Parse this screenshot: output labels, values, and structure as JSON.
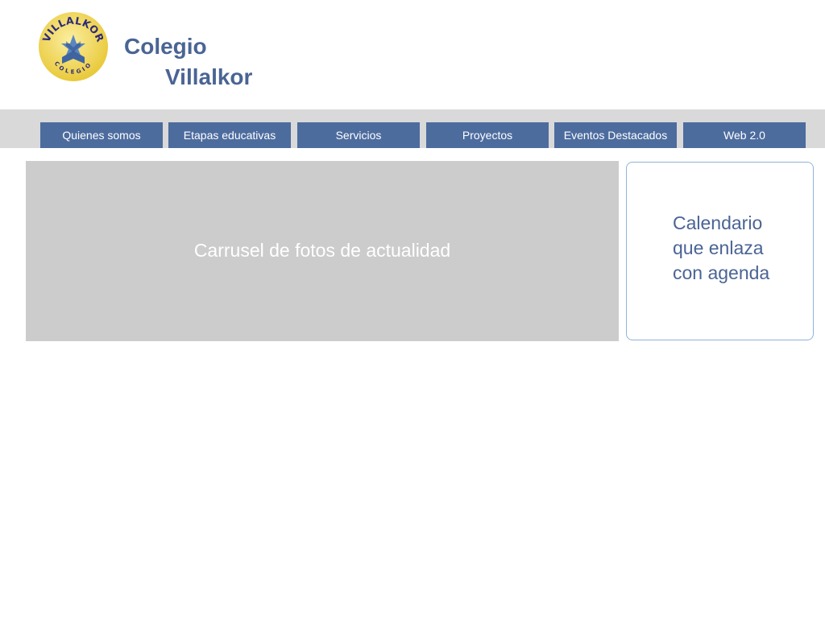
{
  "header": {
    "logo": {
      "top_text": "VILLALKOR",
      "bottom_text": "COLEGIO",
      "icon": "school-emblem-icon",
      "colors": {
        "circle": "#f2d94e",
        "text": "#2b2b7a",
        "emblem": "#4d74ad"
      }
    },
    "title_line1": "Colegio",
    "title_line2": "Villalkor",
    "title_color": "#4a6494"
  },
  "nav": {
    "band_color": "#d9d9d9",
    "button_color": "#4d6c9e",
    "items": [
      {
        "label": "Quienes somos"
      },
      {
        "label": "Etapas educativas"
      },
      {
        "label": "Servicios"
      },
      {
        "label": "Proyectos"
      },
      {
        "label": "Eventos Destacados"
      },
      {
        "label": "Web 2.0"
      }
    ]
  },
  "main": {
    "carousel": {
      "label": "Carrusel de fotos de actualidad",
      "background": "#cccccc"
    },
    "calendar": {
      "lines": [
        "Calendario",
        "que enlaza",
        "con agenda"
      ],
      "border_color": "#8fb3d9"
    }
  }
}
